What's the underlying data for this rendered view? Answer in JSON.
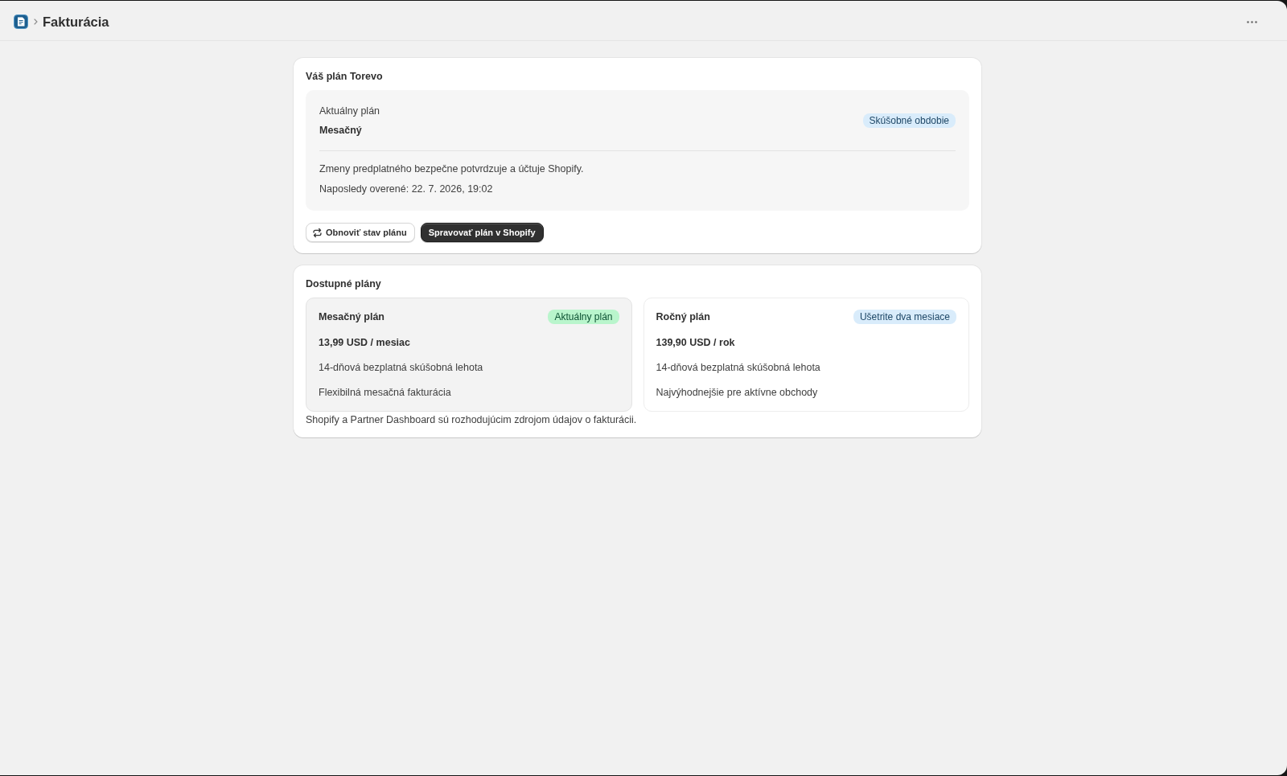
{
  "header": {
    "title": "Fakturácia"
  },
  "subscription": {
    "title": "Váš plán Torevo",
    "current_plan_label": "Aktuálny plán",
    "current_plan_value": "Mesačný",
    "status_badge": {
      "text": "Skúšobné obdobie",
      "kind": "info"
    },
    "info_lines": [
      "Zmeny predplatného bezpečne potvrdzuje a účtuje Shopify.",
      "Naposledy overené: 22. 7. 2026, 19:02"
    ],
    "buttons": [
      {
        "label": "Obnoviť stav plánu",
        "kind": "secondary"
      },
      {
        "label": "Spravovať plán v Shopify",
        "kind": "primary"
      }
    ]
  },
  "available_plans": {
    "title": "Dostupné plány",
    "plans": [
      {
        "name": "Mesačný plán",
        "badge": {
          "text": "Aktuálny plán",
          "kind": "success"
        },
        "price": "13,99 USD / mesiac",
        "features": [
          "14-dňová bezplatná skúšobná lehota",
          "Flexibilná mesačná fakturácia"
        ],
        "current": true
      },
      {
        "name": "Ročný plán",
        "badge": {
          "text": "Ušetrite dva mesiace",
          "kind": "info"
        },
        "price": "139,90 USD / rok",
        "features": [
          "14-dňová bezplatná skúšobná lehota",
          "Najvýhodnejšie pre aktívne obchody"
        ],
        "current": false
      }
    ],
    "footnote": "Shopify a Partner Dashboard sú rozhodujúcim zdrojom údajov o fakturácii."
  }
}
